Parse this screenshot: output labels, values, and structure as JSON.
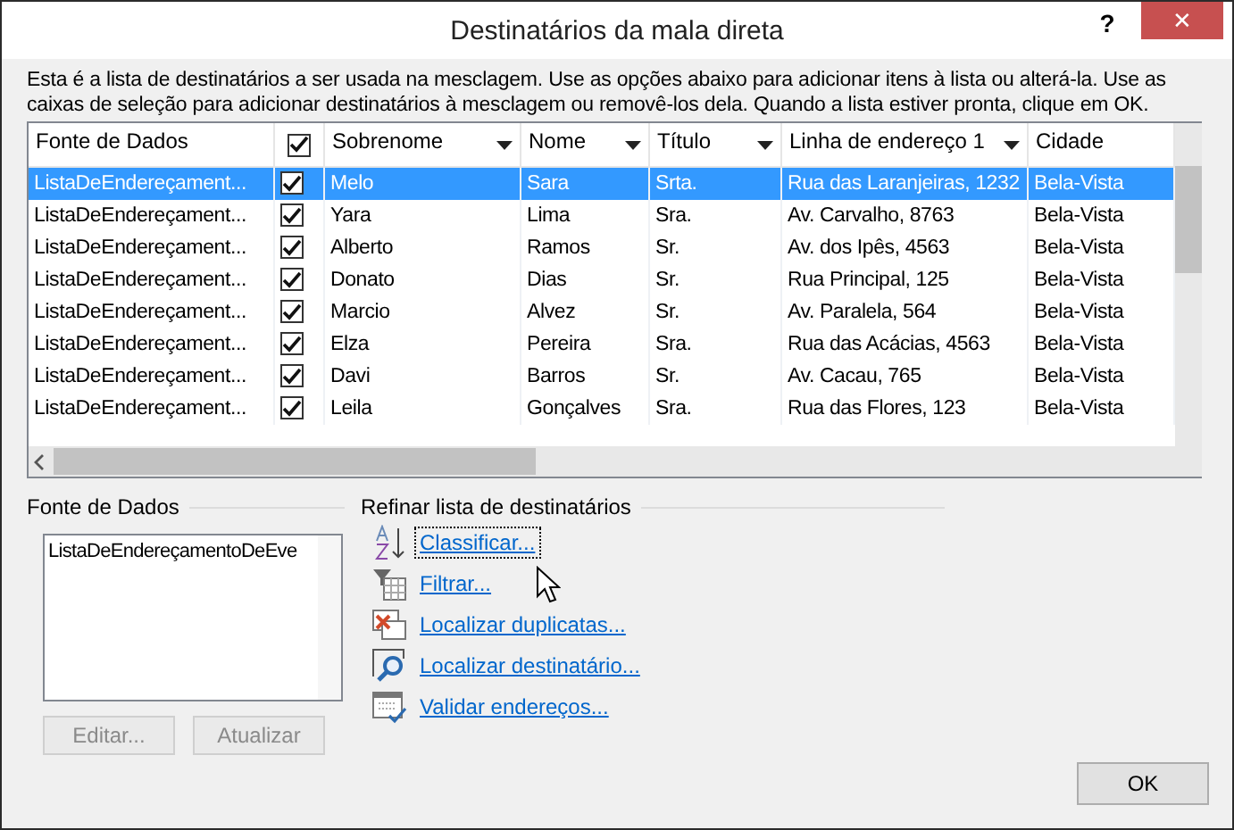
{
  "window": {
    "title": "Destinatários da mala direta",
    "help": "?",
    "close": "✕"
  },
  "intro": "Esta é a lista de destinatários a ser usada na mesclagem. Use as opções abaixo para adicionar itens à lista ou alterá-la. Use as caixas de seleção para adicionar destinatários à mesclagem ou removê-los dela. Quando a lista estiver pronta, clique em OK.",
  "table": {
    "select_all_checked": true,
    "columns": [
      {
        "label": "Fonte de Dados",
        "dropdown": false
      },
      {
        "label": "Sobrenome",
        "dropdown": true
      },
      {
        "label": "Nome",
        "dropdown": true
      },
      {
        "label": "Título",
        "dropdown": true
      },
      {
        "label": "Linha de endereço 1",
        "dropdown": true
      },
      {
        "label": "Cidade",
        "dropdown": false
      }
    ],
    "rows": [
      {
        "selected": true,
        "checked": true,
        "cells": [
          "ListaDeEndereçament...",
          "Melo",
          "Sara",
          "Srta.",
          "Rua das Laranjeiras, 1232",
          "Bela-Vista"
        ]
      },
      {
        "selected": false,
        "checked": true,
        "cells": [
          "ListaDeEndereçament...",
          "Yara",
          "Lima",
          "Sra.",
          "Av. Carvalho, 8763",
          "Bela-Vista"
        ]
      },
      {
        "selected": false,
        "checked": true,
        "cells": [
          "ListaDeEndereçament...",
          "Alberto",
          "Ramos",
          "Sr.",
          "Av. dos Ipês, 4563",
          "Bela-Vista"
        ]
      },
      {
        "selected": false,
        "checked": true,
        "cells": [
          "ListaDeEndereçament...",
          "Donato",
          "Dias",
          "Sr.",
          "Rua Principal, 125",
          "Bela-Vista"
        ]
      },
      {
        "selected": false,
        "checked": true,
        "cells": [
          "ListaDeEndereçament...",
          "Marcio",
          "Alvez",
          "Sr.",
          "Av. Paralela, 564",
          "Bela-Vista"
        ]
      },
      {
        "selected": false,
        "checked": true,
        "cells": [
          "ListaDeEndereçament...",
          "Elza",
          "Pereira",
          "Sra.",
          "Rua das Acácias, 4563",
          "Bela-Vista"
        ]
      },
      {
        "selected": false,
        "checked": true,
        "cells": [
          "ListaDeEndereçament...",
          "Davi",
          "Barros",
          "Sr.",
          "Av. Cacau, 765",
          "Bela-Vista"
        ]
      },
      {
        "selected": false,
        "checked": true,
        "cells": [
          "ListaDeEndereçament...",
          "Leila",
          "Gonçalves",
          "Sra.",
          "Rua das Flores, 123",
          "Bela-Vista"
        ]
      }
    ]
  },
  "data_sources": {
    "label": "Fonte de Dados",
    "items": [
      "ListaDeEndereçamentoDeEve"
    ],
    "buttons": [
      {
        "label": "Editar...",
        "disabled": true
      },
      {
        "label": "Atualizar",
        "disabled": true
      }
    ]
  },
  "refine": {
    "label": "Refinar lista de destinatários",
    "links": [
      {
        "label": "Classificar...",
        "kind": "sort",
        "focused": true
      },
      {
        "label": "Filtrar...",
        "kind": "filter",
        "focused": false
      },
      {
        "label": "Localizar duplicatas...",
        "kind": "duplicates",
        "focused": false
      },
      {
        "label": "Localizar destinatário...",
        "kind": "find",
        "focused": false
      },
      {
        "label": "Validar endereços...",
        "kind": "validate",
        "focused": false
      }
    ]
  },
  "ok_button": "OK"
}
